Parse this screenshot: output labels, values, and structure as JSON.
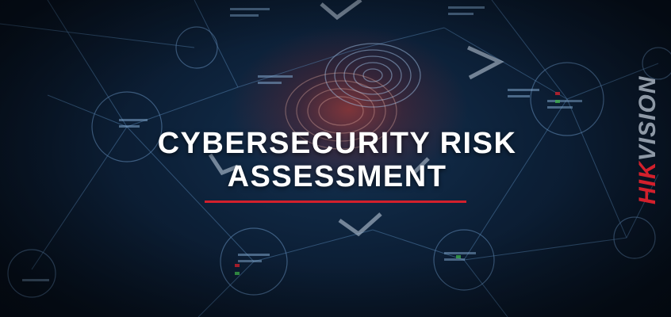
{
  "title": {
    "line1": "CYBERSECURITY RISK",
    "line2": "ASSESSMENT"
  },
  "logo": {
    "part1": "HIK",
    "part2": "VISION"
  },
  "colors": {
    "accent": "#d3202c",
    "background": "#0c1f36",
    "network_lines": "#5e86b0",
    "logo_gray": "#8e99a6",
    "title_text": "#ffffff"
  }
}
